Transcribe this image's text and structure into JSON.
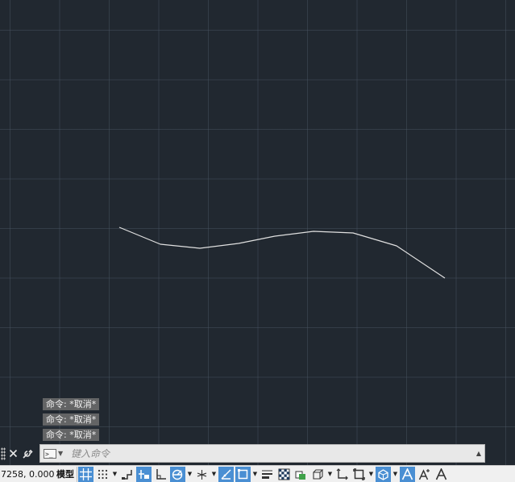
{
  "command_history": [
    "命令: *取消*",
    "命令: *取消*",
    "命令: *取消*"
  ],
  "command_line": {
    "placeholder": "键入命令",
    "close_icon": "close-icon",
    "customize_icon": "wrench-icon",
    "prompt_icon": "command-prompt-icon"
  },
  "status_bar": {
    "coordinates": "7258, 0.0000",
    "model_label": "模型",
    "buttons": [
      {
        "name": "grid-display-button",
        "icon": "grid-icon",
        "active": true
      },
      {
        "name": "snap-mode-button",
        "icon": "snap-dots-icon",
        "active": false
      },
      {
        "name": "infer-constraints-button",
        "icon": "infer-constraints-icon",
        "active": false
      },
      {
        "name": "dynamic-input-button",
        "icon": "dynamic-input-icon",
        "active": true
      },
      {
        "name": "ortho-mode-button",
        "icon": "ortho-icon",
        "active": false
      },
      {
        "name": "polar-tracking-button",
        "icon": "polar-icon",
        "active": true
      },
      {
        "name": "isodraft-button",
        "icon": "isodraft-icon",
        "active": false
      },
      {
        "name": "object-snap-tracking-button",
        "icon": "snap-tracking-icon",
        "active": true
      },
      {
        "name": "object-snap-button",
        "icon": "object-snap-icon",
        "active": true
      },
      {
        "name": "lineweight-button",
        "icon": "lineweight-icon",
        "active": false
      },
      {
        "name": "transparency-button",
        "icon": "transparency-icon",
        "active": false
      },
      {
        "name": "selection-cycling-button",
        "icon": "selection-cycling-icon",
        "active": false
      },
      {
        "name": "3d-object-snap-button",
        "icon": "3d-osnap-icon",
        "active": false
      },
      {
        "name": "dynamic-ucs-button",
        "icon": "dynamic-ucs-icon",
        "active": false
      },
      {
        "name": "selection-filter-button",
        "icon": "selection-filter-icon",
        "active": false
      },
      {
        "name": "gizmo-button",
        "icon": "gizmo-icon",
        "active": true
      },
      {
        "name": "annotation-visibility-button",
        "icon": "annotation-icon",
        "active": true
      },
      {
        "name": "auto-scale-button",
        "icon": "auto-scale-icon",
        "active": false
      },
      {
        "name": "annotation-scale-button",
        "icon": "annotation-scale-icon",
        "active": false
      }
    ]
  },
  "colors": {
    "canvas": "#212830",
    "grid": "#4a5664",
    "polyline": "#e0e0e0",
    "active_button": "#4a8fd3"
  }
}
